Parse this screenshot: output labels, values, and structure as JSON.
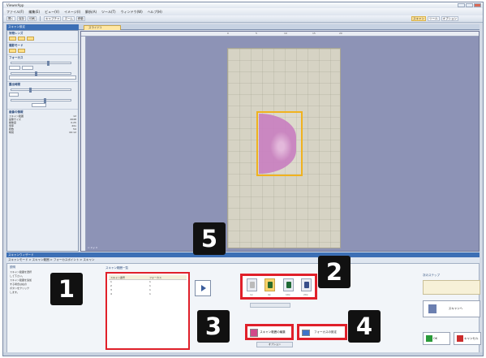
{
  "window": {
    "title": "ViewerApp"
  },
  "menu": [
    "ファイル(F)",
    "編集(E)",
    "ビュー(V)",
    "イメージ(I)",
    "解析(A)",
    "ツール(T)",
    "ウィンドウ(W)",
    "ヘルプ(H)"
  ],
  "toolbar": {
    "left": [
      "開く",
      "保存",
      "印刷",
      "キャプチャ",
      "ズーム",
      "移動"
    ],
    "right": [
      "スキャン",
      "ツール",
      "オプション"
    ]
  },
  "left_panel": {
    "header": "スキャン設定",
    "sections": [
      {
        "title": "対物レンズ"
      },
      {
        "title": "撮影モード"
      },
      {
        "title": "フォーカス"
      },
      {
        "title": "露出時間"
      },
      {
        "title": "画像の情報"
      }
    ],
    "info": [
      [
        "スキャン範囲",
        "12"
      ],
      [
        "画像サイズ",
        "2048"
      ],
      [
        "解像度",
        "0.25"
      ],
      [
        "倍率",
        "20x"
      ],
      [
        "枚数",
        "54"
      ],
      [
        "時間",
        "00:12"
      ]
    ]
  },
  "tab": {
    "label": "スライド1"
  },
  "viewer": {
    "status": "x: 0 y: 0"
  },
  "ruler": [
    "0",
    "5",
    "10",
    "15",
    "20"
  ],
  "bottom": {
    "header": "スキャンウィザード",
    "wizard": "スキャンモード > スキャン範囲 > フォーカスポイント > スキャン",
    "desc_label": "説明",
    "description": [
      "スキャン範囲を選択",
      "して下さい。",
      "スキャン範囲を追加",
      "する場合は右の",
      "ボタンをクリック",
      "します。"
    ],
    "list_label": "スキャン範囲一覧",
    "list": {
      "headers": [
        "スキャン番号",
        "フォーカス"
      ],
      "rows": [
        [
          "1",
          "1"
        ],
        [
          "2",
          "1"
        ],
        [
          "3",
          "1"
        ],
        [
          "4",
          "1"
        ]
      ]
    },
    "icon_labels": [
      "1x",
      "4x",
      "10x",
      "20x"
    ],
    "button3": "スキャン範囲の編集",
    "button4": "フォーカスの設定",
    "below3": "オプション",
    "right_label": "次のステップ",
    "right_button": "スキャンへ",
    "ok": "OK",
    "cancel": "キャンセル"
  },
  "callouts": [
    "1",
    "2",
    "3",
    "4",
    "5"
  ]
}
